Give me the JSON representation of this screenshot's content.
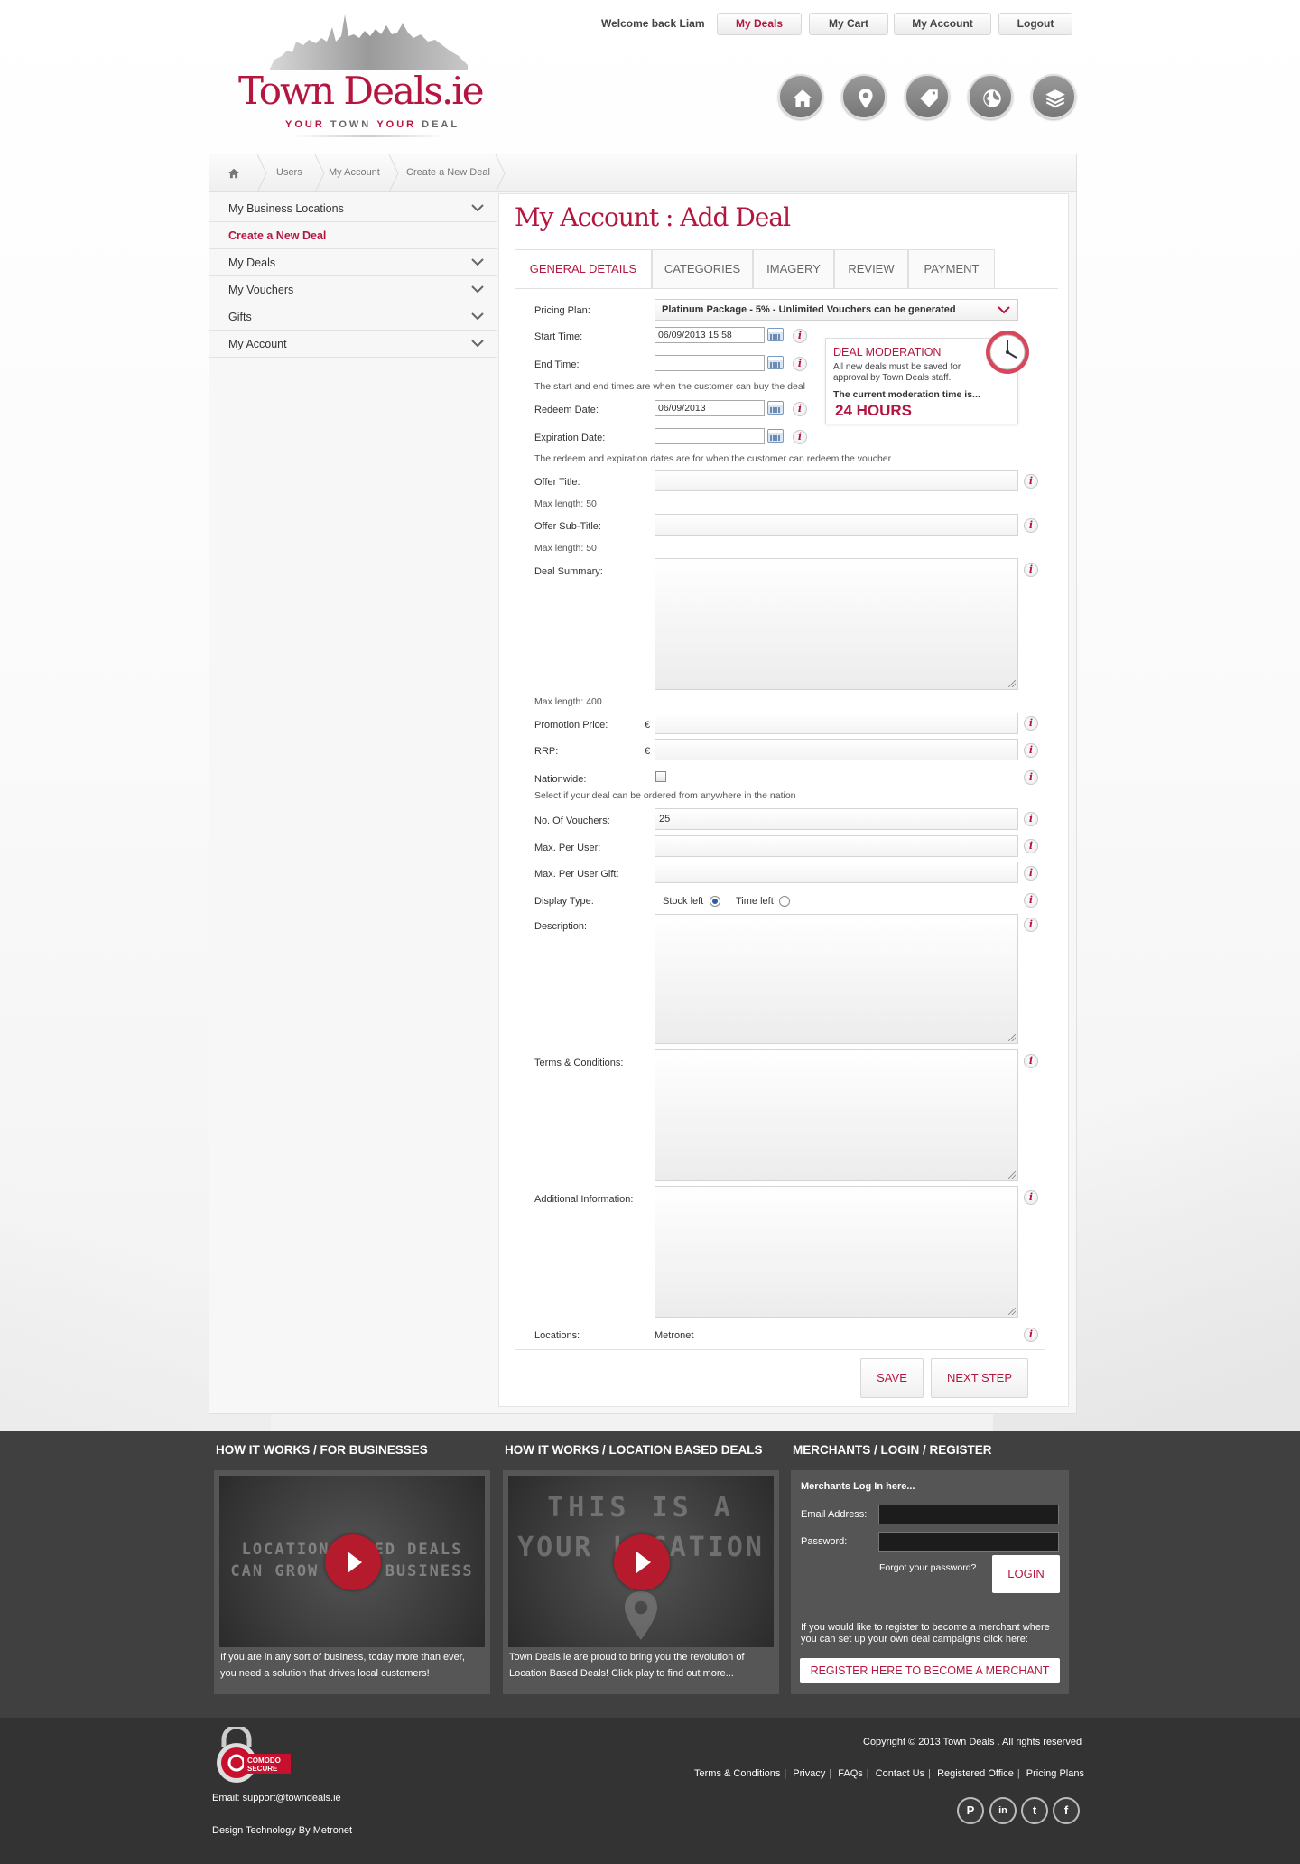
{
  "header": {
    "brand": "Town Deals.ie",
    "tagline_parts": [
      "YOUR",
      "TOWN",
      "YOUR",
      "DEAL"
    ],
    "welcome": "Welcome back Liam",
    "top_nav": [
      "My Deals",
      "My Cart",
      "My Account",
      "Logout"
    ],
    "icon_nav": [
      "home-icon",
      "location-pin-icon",
      "tag-icon",
      "globe-icon",
      "layers-icon"
    ]
  },
  "breadcrumb": [
    "Users",
    "My Account",
    "Create a New Deal"
  ],
  "sidebar": {
    "items": [
      {
        "label": "My Business Locations",
        "expandable": true
      },
      {
        "label": "Create a New Deal",
        "active": true
      },
      {
        "label": "My Deals",
        "expandable": true
      },
      {
        "label": "My Vouchers",
        "expandable": true
      },
      {
        "label": "Gifts",
        "expandable": true
      },
      {
        "label": "My Account",
        "expandable": true
      }
    ]
  },
  "page": {
    "title": "My Account : Add Deal",
    "tabs": [
      "GENERAL DETAILS",
      "CATEGORIES",
      "IMAGERY",
      "REVIEW",
      "PAYMENT"
    ],
    "active_tab": "GENERAL DETAILS"
  },
  "form": {
    "pricing_plan_label": "Pricing Plan:",
    "pricing_plan_value": "Platinum Package - 5% - Unlimited Vouchers can be generated",
    "start_time_label": "Start Time:",
    "start_time_value": "06/09/2013 15:58",
    "end_time_label": "End Time:",
    "end_time_value": "",
    "start_end_note": "The start and end times are when the customer can buy the deal",
    "redeem_date_label": "Redeem Date:",
    "redeem_date_value": "06/09/2013",
    "expiration_date_label": "Expiration Date:",
    "expiration_date_value": "",
    "redeem_note": "The redeem and expiration dates are for when the customer can redeem the voucher",
    "offer_title_label": "Offer Title:",
    "offer_title_max": "Max length: 50",
    "offer_subtitle_label": "Offer Sub-Title:",
    "offer_subtitle_max": "Max length: 50",
    "deal_summary_label": "Deal Summary:",
    "deal_summary_max": "Max length: 400",
    "promotion_price_label": "Promotion Price:",
    "rrp_label": "RRP:",
    "currency": "€",
    "nationwide_label": "Nationwide:",
    "nationwide_note": "Select if your deal can be ordered from anywhere in the nation",
    "vouchers_label": "No. Of Vouchers:",
    "vouchers_value": "25",
    "max_per_user_label": "Max. Per User:",
    "max_per_user_gift_label": "Max. Per User Gift:",
    "display_type_label": "Display Type:",
    "display_options": [
      "Stock left",
      "Time left"
    ],
    "display_selected": "Stock left",
    "description_label": "Description:",
    "terms_label": "Terms & Conditions:",
    "additional_label": "Additional Information:",
    "locations_label": "Locations:",
    "locations_value": "Metronet",
    "info_glyph": "i",
    "save_label": "SAVE",
    "next_label": "NEXT STEP"
  },
  "moderation": {
    "title": "DEAL MODERATION",
    "text": "All new deals must be saved for approval by Town Deals staff.",
    "current": "The current moderation time is...",
    "hours": "24 HOURS"
  },
  "footer": {
    "businesses_heading": "HOW IT WORKS / FOR BUSINESSES",
    "businesses_video_text": [
      "LOCATION BASED DEALS",
      "CAN GROW YOUR BUSINESS"
    ],
    "businesses_caption": "If you are in any sort of business, today more than ever, you need a solution that drives local customers!",
    "location_heading": "HOW IT WORKS / LOCATION BASED DEALS",
    "location_video_text": [
      "THIS IS A",
      "YOUR LOCATION"
    ],
    "location_caption": "Town Deals.ie are proud to bring you the revolution of Location Based Deals! Click play to find out more...",
    "merchants_heading": "MERCHANTS / LOGIN / REGISTER",
    "merchants_title": "Merchants Log In here...",
    "email_label": "Email Address:",
    "password_label": "Password:",
    "forgot": "Forgot your password?",
    "login": "LOGIN",
    "register_text": "If you would like to register to become a merchant where you can set up your own deal campaigns click here:",
    "register_button": "REGISTER HERE TO BECOME A MERCHANT",
    "comodo": [
      "COMODO",
      "SECURE"
    ],
    "email": "Email: support@towndeals.ie",
    "credit": "Design Technology By Metronet",
    "copyright": "Copyright © 2013 Town Deals . All rights reserved",
    "links": [
      "Terms & Conditions",
      "Privacy",
      "FAQs",
      "Contact Us",
      "Registered Office",
      "Pricing Plans"
    ],
    "social": [
      "pinterest-icon",
      "linkedin-icon",
      "twitter-icon",
      "facebook-icon"
    ],
    "social_glyphs": [
      "P",
      "in",
      "t",
      "f"
    ]
  },
  "colors": {
    "brand_red": "#b5163f",
    "footer_dark": "#404040",
    "footer_darker": "#333333"
  }
}
